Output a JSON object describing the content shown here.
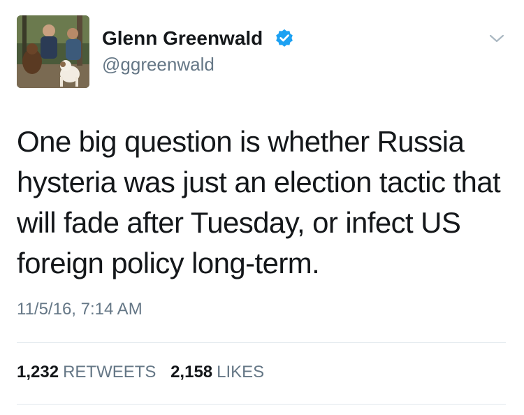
{
  "author": {
    "display_name": "Glenn Greenwald",
    "handle": "@ggreenwald",
    "verified": true,
    "avatar_icon": "profile-photo-with-dogs"
  },
  "tweet": {
    "lines": [
      "One big question is whether Russia",
      "hysteria was just an election tactic that",
      "will fade after Tuesday, or infect US",
      "foreign policy long-term."
    ],
    "timestamp": "11/5/16, 7:14 AM"
  },
  "stats": {
    "retweets_count": "1,232",
    "retweets_label": "RETWEETS",
    "likes_count": "2,158",
    "likes_label": "LIKES"
  },
  "colors": {
    "text": "#14171a",
    "secondary": "#657786",
    "verified_blue": "#1da1f2",
    "divider": "#e1e8ed"
  },
  "icons": {
    "menu": "chevron-down-icon",
    "verified": "verified-badge-icon"
  }
}
